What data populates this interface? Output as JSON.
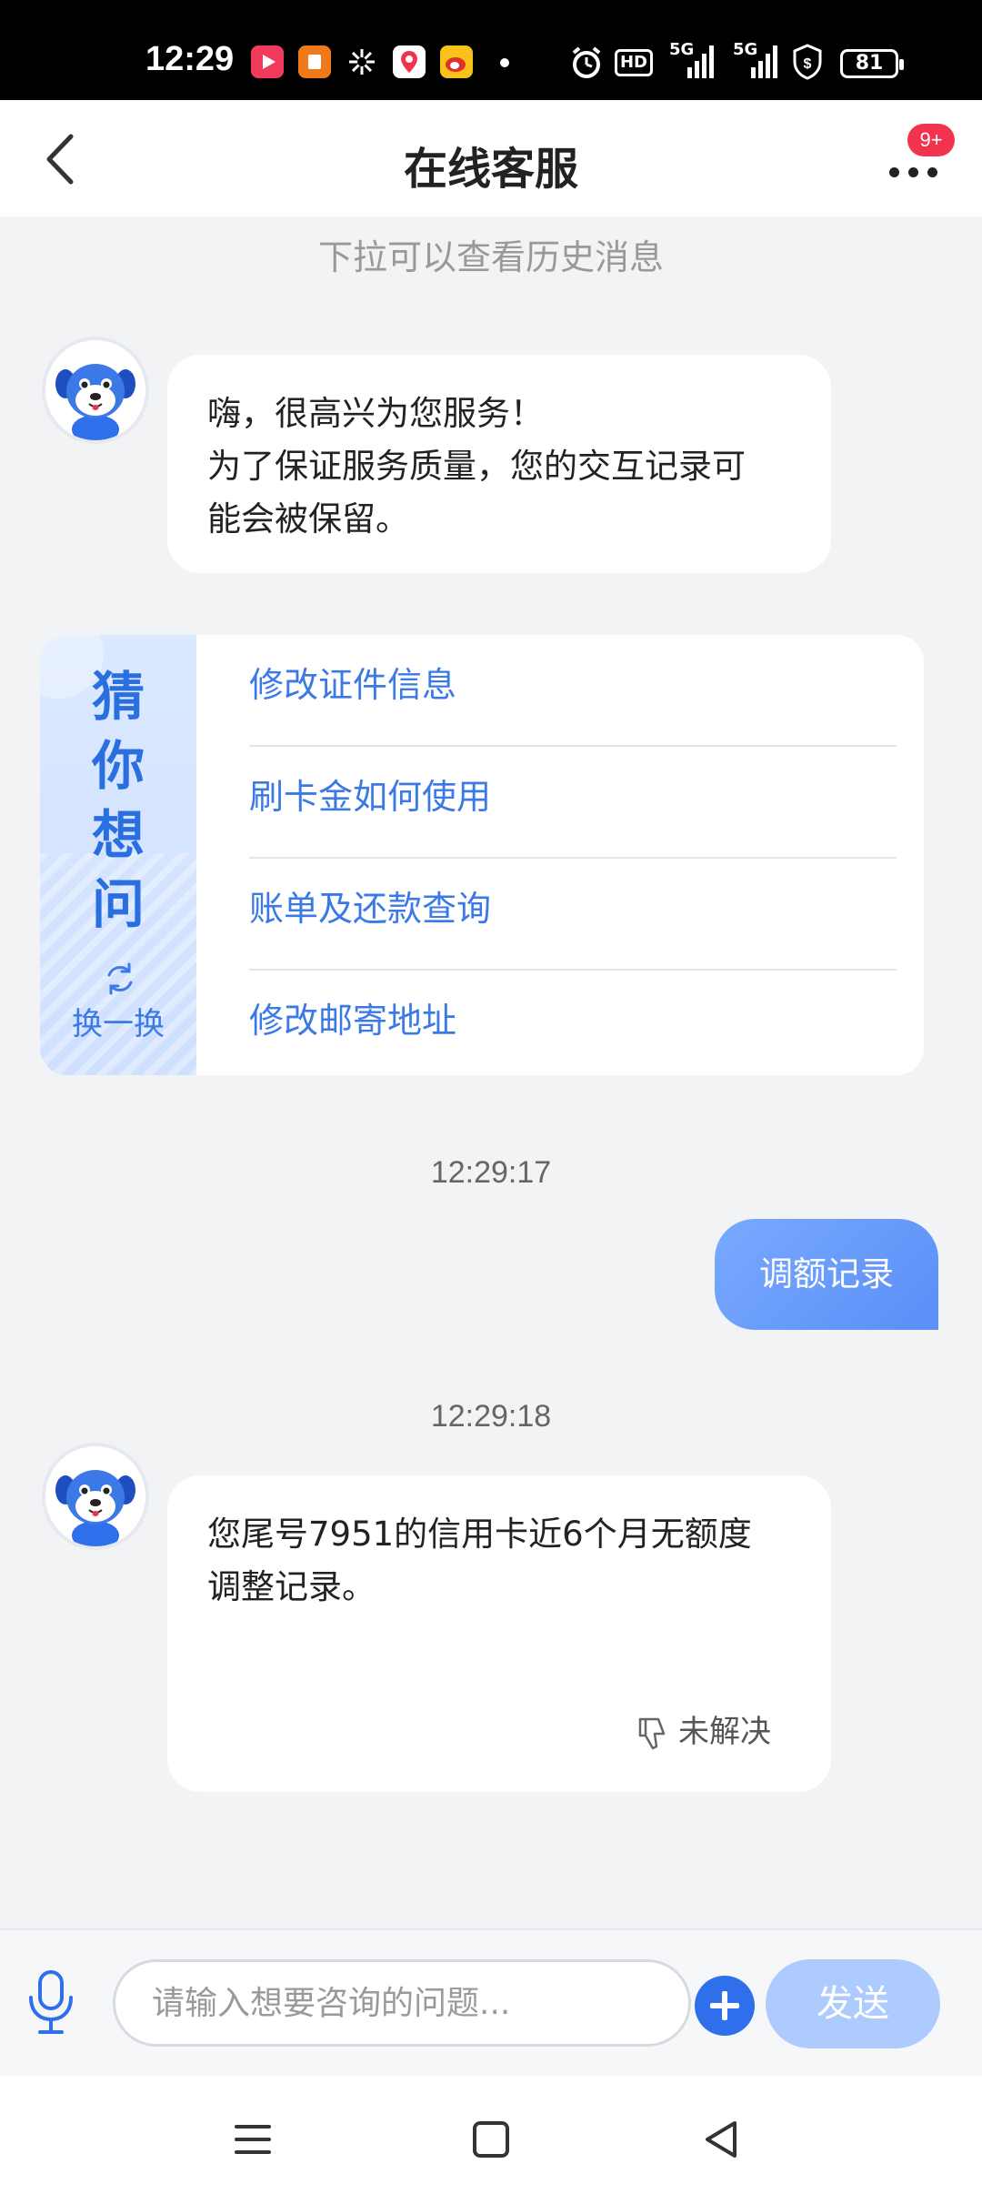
{
  "status_bar": {
    "time": "12:29",
    "network_1": "5G",
    "network_2": "5G",
    "hd_label": "HD",
    "battery": "81"
  },
  "header": {
    "title": "在线客服",
    "badge": "9+"
  },
  "history_hint": "下拉可以查看历史消息",
  "messages": {
    "welcome": "嗨，很高兴为您服务！\n为了保证服务质量，您的交互记录可\n能会被保留。",
    "timestamp_1": "12:29:17",
    "user_message": "调额记录",
    "timestamp_2": "12:29:18",
    "reply": "您尾号7951的信用卡近6个月无额度\n调整记录。",
    "feedback_label": "未解决"
  },
  "guess": {
    "title_chars": [
      "猜",
      "你",
      "想",
      "问"
    ],
    "refresh_label": "换一换",
    "items": [
      "修改证件信息",
      "刷卡金如何使用",
      "账单及还款查询",
      "修改邮寄地址"
    ]
  },
  "input_bar": {
    "placeholder": "请输入想要咨询的问题...",
    "send_label": "发送"
  },
  "colors": {
    "accent": "#3b7ae6",
    "user_bubble": "#6b9cfb",
    "send_disabled": "#aecbff",
    "badge": "#f2334d"
  }
}
